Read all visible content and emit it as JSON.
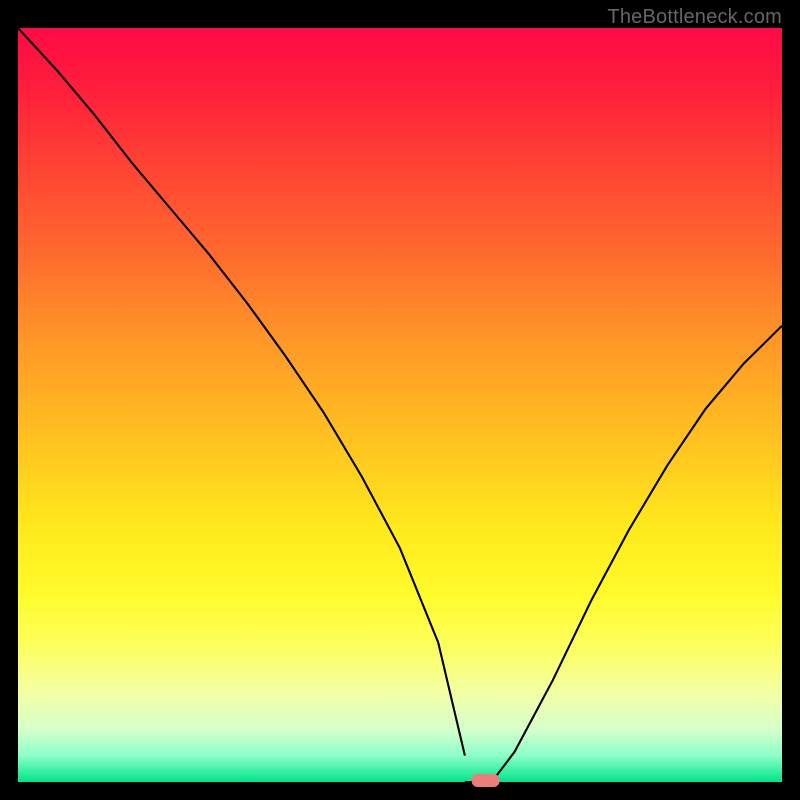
{
  "watermark": "TheBottleneck.com",
  "chart_data": {
    "type": "line",
    "title": "",
    "xlabel": "",
    "ylabel": "",
    "x": [
      0.0,
      0.05,
      0.1,
      0.15,
      0.2,
      0.25,
      0.3,
      0.35,
      0.4,
      0.45,
      0.5,
      0.55,
      0.585,
      0.6,
      0.62,
      0.65,
      0.7,
      0.75,
      0.8,
      0.85,
      0.9,
      0.95,
      1.0
    ],
    "values": [
      1.0,
      0.945,
      0.885,
      0.82,
      0.76,
      0.7,
      0.635,
      0.565,
      0.49,
      0.405,
      0.31,
      0.185,
      0.035,
      0.0,
      0.0,
      0.04,
      0.135,
      0.24,
      0.335,
      0.42,
      0.495,
      0.555,
      0.605
    ],
    "min_marker_x": 0.612,
    "min_marker_y": 0.0,
    "ylim": [
      0,
      1
    ],
    "xlim": [
      0,
      1
    ]
  }
}
